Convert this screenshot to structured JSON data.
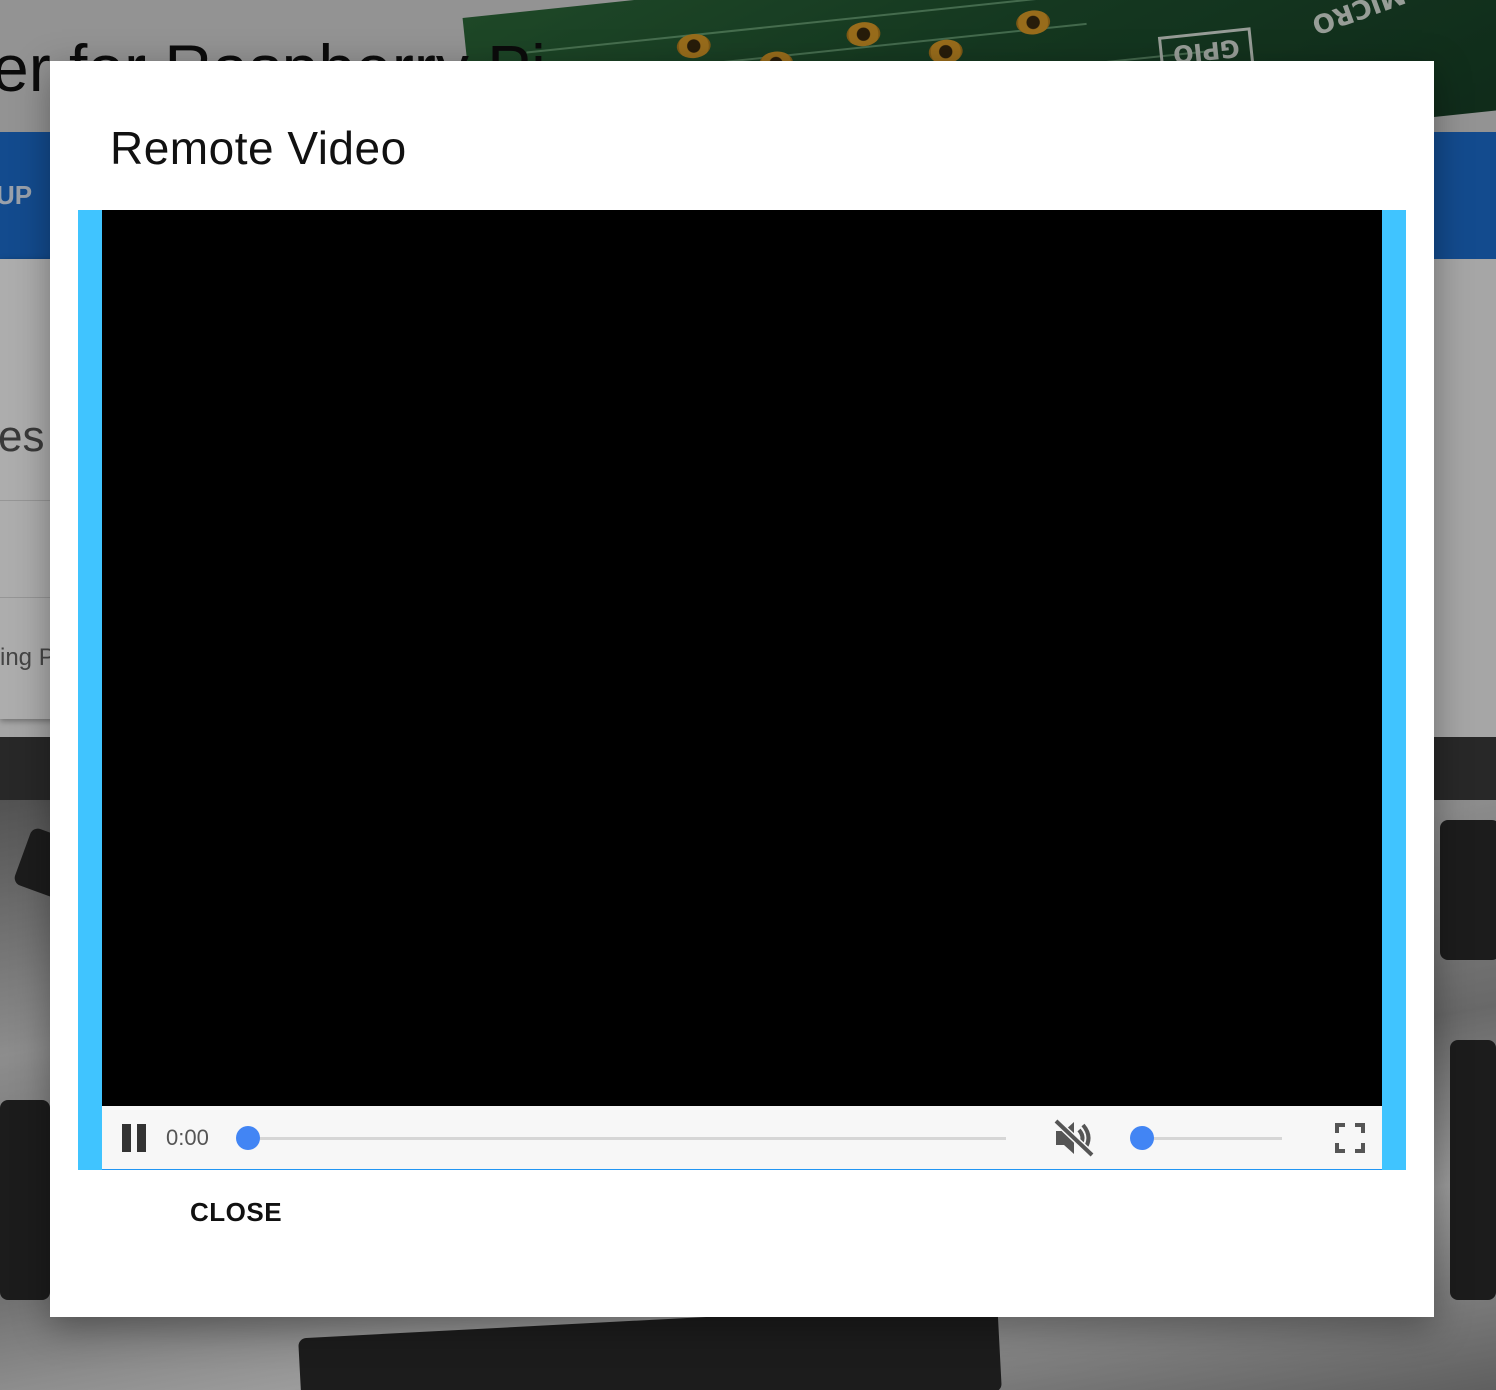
{
  "background": {
    "title_fragment": "er for Raspberry Pi",
    "nav_fragment": "UP",
    "heading_fragment": "es",
    "text_fragment": "ing P",
    "board_gpio_label": "GPIO",
    "board_micro_label": "MICRO"
  },
  "modal": {
    "title": "Remote Video",
    "player": {
      "time": "0:00",
      "progress": 0,
      "volume": 0,
      "muted": true,
      "playing": true
    },
    "close_label": "CLOSE"
  },
  "colors": {
    "video_frame": "#40c4ff",
    "slider_accent": "#4285f4",
    "nav_bar": "#1c6fd1"
  },
  "icons": [
    "pause-icon",
    "volume-muted-icon",
    "fullscreen-icon"
  ]
}
